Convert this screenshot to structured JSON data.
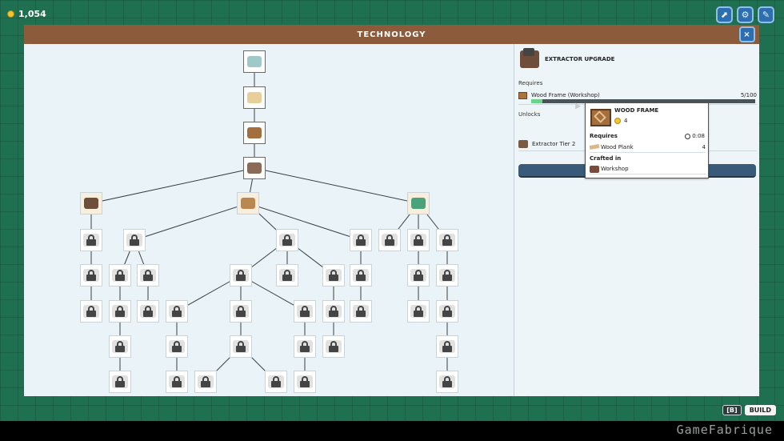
{
  "hud": {
    "coins": "1,054",
    "buttons": [
      {
        "icon": "map-icon",
        "glyph": "⬈"
      },
      {
        "icon": "gear-icon",
        "glyph": "⚙"
      },
      {
        "icon": "codex-icon",
        "glyph": "✎"
      }
    ],
    "build_key": "[B]",
    "build_label": "BUILD"
  },
  "window": {
    "title": "TECHNOLOGY",
    "close_glyph": "×"
  },
  "detail": {
    "title": "EXTRACTOR UPGRADE",
    "requires_label": "Requires",
    "requirement": {
      "name": "Wood Frame (Workshop)",
      "count": "5/100",
      "progress": 0.05
    },
    "unlocks_label": "Unlocks",
    "unlock": {
      "name": "Extractor Tier 2"
    }
  },
  "tooltip": {
    "title": "WOOD FRAME",
    "cost": "4",
    "requires_label": "Requires",
    "time": "0:08",
    "ingredient": {
      "name": "Wood Plank",
      "qty": "4"
    },
    "crafted_in_label": "Crafted in",
    "crafted_in": "Workshop"
  },
  "watermark": "GameFabrique"
}
